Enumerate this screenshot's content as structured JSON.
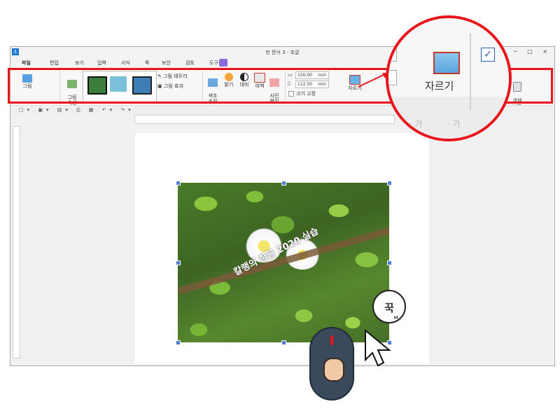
{
  "window": {
    "title": "빈 문서 3 - 호글",
    "controls": "- ? ─ □ ×"
  },
  "menu": [
    {
      "label": "파일"
    },
    {
      "label": "편집"
    },
    {
      "label": "보기"
    },
    {
      "label": "입력"
    },
    {
      "label": "서식"
    },
    {
      "label": "쪽"
    },
    {
      "label": "보안"
    },
    {
      "label": "검토"
    },
    {
      "label": "도구"
    }
  ],
  "ribbon": {
    "picture_label": "그림",
    "picture_props_label": "그림\n속성",
    "picture_border_label": "그림 테두리",
    "picture_effect_label": "그림 효과",
    "color_adjust_label": "색조\n조정",
    "brightness_label": "밝기",
    "contrast_label": "대비",
    "margin_label": "여백",
    "photo_edit_label": "사진\n편집",
    "width_value": "150.00",
    "width_unit": "mm",
    "height_value": "112.50",
    "height_unit": "mm",
    "size_lock_label": "크기 고정",
    "crop_label": "자르기",
    "object_protect_label": "개체\n보호"
  },
  "magnifier": {
    "crop_label": "자르기",
    "toolbar_fragment_1": "· 가",
    "toolbar_fragment_2": "· 가"
  },
  "document": {
    "caption": "칼랭의 한글 2020 실습"
  },
  "callout": {
    "text": "꾹",
    "marks": "\""
  },
  "colors": {
    "highlight": "#e8141c",
    "accent": "#1976d2",
    "tool_tab": "#8e6bd8",
    "selection_handle": "#4f7fd6"
  },
  "icons": {
    "app": "hancom-app-icon",
    "crop": "crop-icon",
    "mouse": "mouse-click-icon",
    "cursor": "arrow-cursor-icon"
  }
}
